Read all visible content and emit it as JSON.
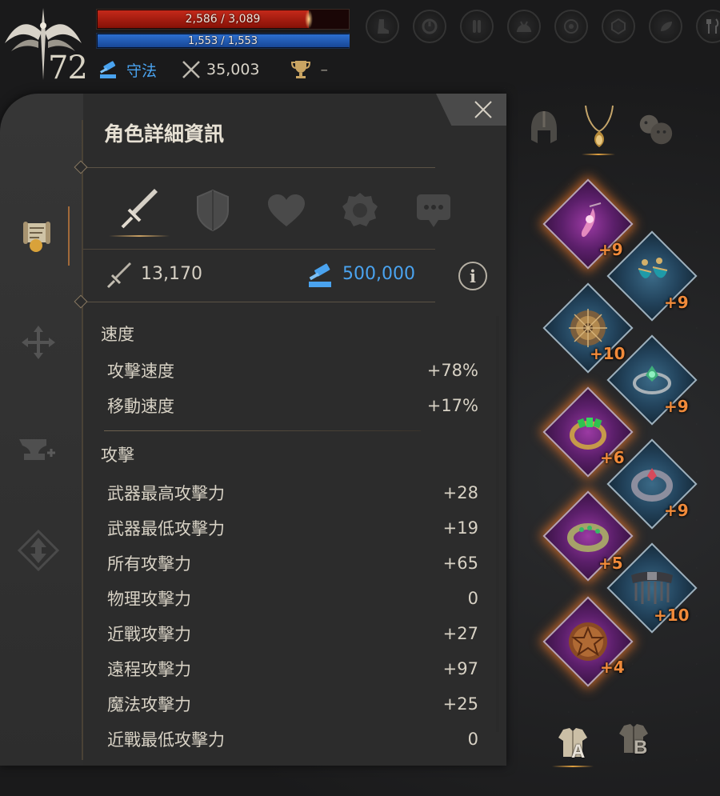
{
  "hud": {
    "level": "72",
    "hp_text": "2,586 / 3,089",
    "hp_ratio": 0.837,
    "mp_text": "1,553 / 1,553",
    "mp_ratio": 1.0,
    "alignment_label": "守法",
    "combat_power": "35,003",
    "ranking": "–",
    "buff_icons": [
      "boots-buff-icon",
      "cooldown-buff-icon",
      "potion-buff-icon",
      "creature-buff-icon",
      "target-buff-icon",
      "shield-buff-icon",
      "herb-buff-icon",
      "food-buff-icon"
    ]
  },
  "panel": {
    "title": "角色詳細資訊",
    "tabs": [
      "sword-tab",
      "shield-tab",
      "heart-tab",
      "gear-tab",
      "chat-tab"
    ],
    "attack_power": "13,170",
    "guard_value": "500,000",
    "info_label": "i",
    "sections": [
      {
        "title": "速度",
        "rows": [
          {
            "label": "攻擊速度",
            "value": "+78%"
          },
          {
            "label": "移動速度",
            "value": "+17%"
          }
        ]
      },
      {
        "title": "攻擊",
        "rows": [
          {
            "label": "武器最高攻擊力",
            "value": "+28"
          },
          {
            "label": "武器最低攻擊力",
            "value": "+19"
          },
          {
            "label": "所有攻擊力",
            "value": "+65"
          },
          {
            "label": "物理攻擊力",
            "value": "0"
          },
          {
            "label": "近戰攻擊力",
            "value": "+27"
          },
          {
            "label": "遠程攻擊力",
            "value": "+97"
          },
          {
            "label": "魔法攻擊力",
            "value": "+25"
          },
          {
            "label": "近戰最低攻擊力",
            "value": "0"
          }
        ]
      }
    ]
  },
  "equipment": {
    "slots": [
      {
        "name": "necklace-slot",
        "enhance": "+9",
        "rarity": "purple"
      },
      {
        "name": "earring-slot",
        "enhance": "+9",
        "rarity": "blue"
      },
      {
        "name": "amulet-slot",
        "enhance": "+10",
        "rarity": "blue"
      },
      {
        "name": "bracelet-slot",
        "enhance": "+9",
        "rarity": "blue"
      },
      {
        "name": "ring-left-slot",
        "enhance": "+6",
        "rarity": "purple"
      },
      {
        "name": "ring-right-slot",
        "enhance": "+9",
        "rarity": "blue"
      },
      {
        "name": "bangle-slot",
        "enhance": "+5",
        "rarity": "purple"
      },
      {
        "name": "belt-slot",
        "enhance": "+10",
        "rarity": "blue"
      },
      {
        "name": "emblem-slot",
        "enhance": "+4",
        "rarity": "purple"
      }
    ],
    "set_a_label": "A",
    "set_b_label": "B"
  },
  "colors": {
    "accent_orange": "#f08a3a",
    "alignment_blue": "#4aa3ef",
    "hp_red": "#c4291a",
    "mp_blue": "#2c6fd0"
  }
}
